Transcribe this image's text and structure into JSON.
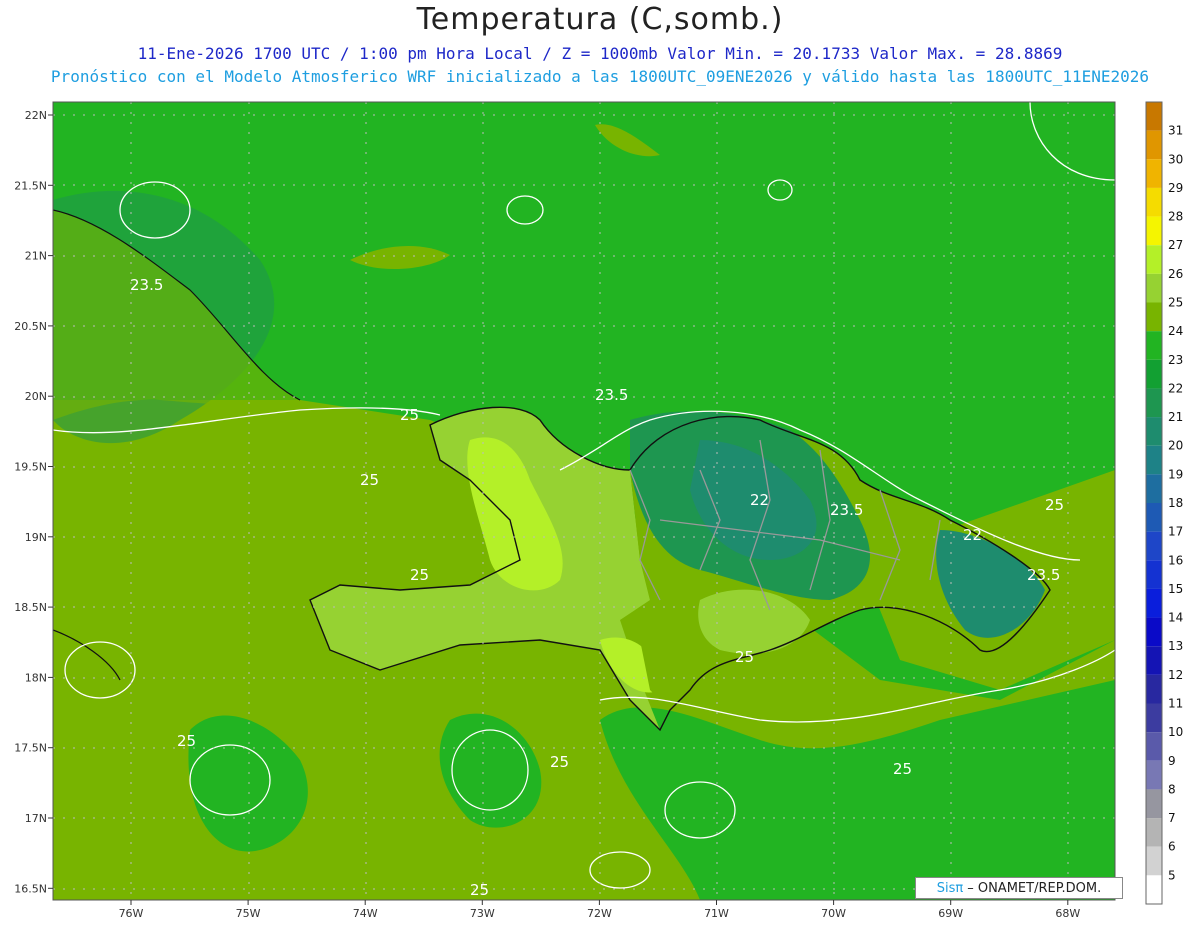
{
  "title": "Temperatura (C,somb.)",
  "subtitle_line1": "11-Ene-2026  1700 UTC / 1:00 pm Hora Local / Z = 1000mb   Valor Min. = 20.1733  Valor Max. = 28.8869",
  "subtitle_line2": "Pronóstico con el Modelo Atmosferico WRF inicializado a las 1800UTC_09ENE2026 y válido hasta las  1800UTC_11ENE2026",
  "credit": {
    "brand": "Sisπ",
    "org": "– ONAMET/REP.DOM."
  },
  "lat_ticks": [
    "22N",
    "21.5N",
    "21N",
    "20.5N",
    "20N",
    "19.5N",
    "19N",
    "18.5N",
    "18N",
    "17.5N",
    "17N",
    "16.5N"
  ],
  "lon_ticks": [
    "76W",
    "75W",
    "74W",
    "73W",
    "72W",
    "71W",
    "70W",
    "69W",
    "68W"
  ],
  "colorbar": {
    "labels": [
      "31",
      "30",
      "29",
      "28",
      "27",
      "26",
      "25",
      "24",
      "23",
      "22",
      "21",
      "20",
      "19",
      "18",
      "17",
      "16",
      "15",
      "14",
      "13",
      "12",
      "11",
      "10",
      "9",
      "8",
      "7",
      "6",
      "5"
    ],
    "colors": [
      "#c87800",
      "#e09600",
      "#f0b400",
      "#f5dc00",
      "#f5f500",
      "#b4f028",
      "#96d232",
      "#78b400",
      "#22b422",
      "#12a032",
      "#1e9650",
      "#1e8c6e",
      "#1e8287",
      "#1e6ea0",
      "#1e5ab4",
      "#1e46c8",
      "#1432d2",
      "#0a1edc",
      "#0a0ac8",
      "#1414b4",
      "#2828a0",
      "#3c3ca0",
      "#5a5aaa",
      "#7878b4",
      "#9696a0",
      "#b4b4b4",
      "#d2d2d2",
      "#ffffff"
    ]
  },
  "contour_labels": [
    "25",
    "23.5",
    "22",
    "23.5"
  ],
  "palette": {
    "ocean": "#22b422",
    "land_warm": "#78b400",
    "land_hot": "#b4f028",
    "cool": "#1e9650",
    "coolest": "#1e8c6e"
  }
}
